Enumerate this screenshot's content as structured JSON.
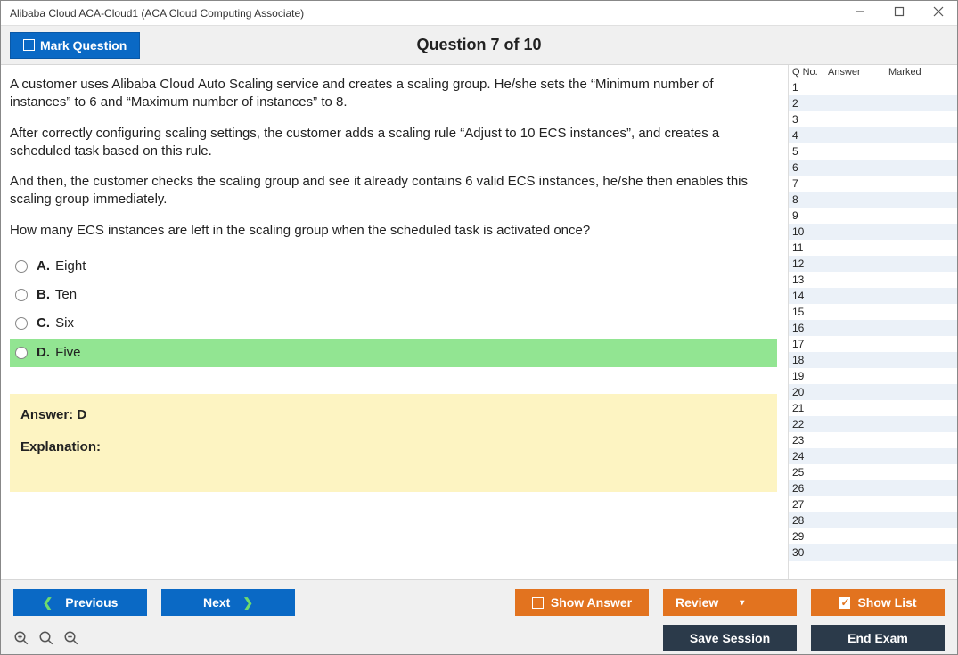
{
  "window": {
    "title": "Alibaba Cloud ACA-Cloud1 (ACA Cloud Computing Associate)"
  },
  "toolbar": {
    "mark_question": "Mark Question",
    "question_title": "Question 7 of 10"
  },
  "question": {
    "paragraphs": [
      "A customer uses Alibaba Cloud Auto Scaling service and creates a scaling group. He/she sets the “Minimum number of instances” to 6 and “Maximum number of instances” to 8.",
      "After correctly configuring scaling settings, the customer adds a scaling rule “Adjust to 10 ECS instances”, and creates a scheduled task based on this rule.",
      "And then, the customer checks the scaling group and see it already contains 6 valid ECS instances, he/she then enables this scaling group immediately.",
      "How many ECS instances are left in the scaling group when the scheduled task is activated once?"
    ],
    "options": [
      {
        "letter": "A.",
        "text": "Eight",
        "highlight": false
      },
      {
        "letter": "B.",
        "text": "Ten",
        "highlight": false
      },
      {
        "letter": "C.",
        "text": "Six",
        "highlight": false
      },
      {
        "letter": "D.",
        "text": "Five",
        "highlight": true
      }
    ],
    "answer_label": "Answer: D",
    "explanation_label": "Explanation:"
  },
  "sidebar": {
    "headers": {
      "qno": "Q No.",
      "answer": "Answer",
      "marked": "Marked"
    },
    "rows": [
      {
        "n": "1"
      },
      {
        "n": "2"
      },
      {
        "n": "3"
      },
      {
        "n": "4"
      },
      {
        "n": "5"
      },
      {
        "n": "6"
      },
      {
        "n": "7"
      },
      {
        "n": "8"
      },
      {
        "n": "9"
      },
      {
        "n": "10"
      },
      {
        "n": "11"
      },
      {
        "n": "12"
      },
      {
        "n": "13"
      },
      {
        "n": "14"
      },
      {
        "n": "15"
      },
      {
        "n": "16"
      },
      {
        "n": "17"
      },
      {
        "n": "18"
      },
      {
        "n": "19"
      },
      {
        "n": "20"
      },
      {
        "n": "21"
      },
      {
        "n": "22"
      },
      {
        "n": "23"
      },
      {
        "n": "24"
      },
      {
        "n": "25"
      },
      {
        "n": "26"
      },
      {
        "n": "27"
      },
      {
        "n": "28"
      },
      {
        "n": "29"
      },
      {
        "n": "30"
      }
    ]
  },
  "footer": {
    "previous": "Previous",
    "next": "Next",
    "show_answer": "Show Answer",
    "review": "Review",
    "show_list": "Show List",
    "save_session": "Save Session",
    "end_exam": "End Exam"
  }
}
